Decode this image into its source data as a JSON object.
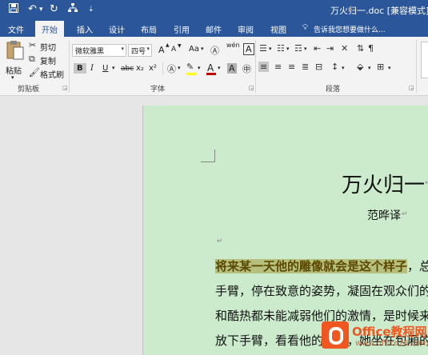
{
  "title_bar": {
    "save_icon": "save-icon",
    "undo_icon": "undo-icon",
    "redo_icon": "redo-icon",
    "network_icon": "tree-icon",
    "customize": "⇣",
    "document_title": "万火归一.doc [兼容模式] - W"
  },
  "tabs": [
    "文件",
    "开始",
    "插入",
    "设计",
    "布局",
    "引用",
    "邮件",
    "审阅",
    "视图"
  ],
  "active_tab": "开始",
  "tell_me": "告诉我您想要做什么...",
  "clipboard": {
    "paste": "粘贴",
    "cut": "剪切",
    "copy": "复制",
    "format_painter": "格式刷",
    "group_label": "剪贴板"
  },
  "font": {
    "font_name": "微软雅黑",
    "font_size": "四号",
    "group_label": "字体",
    "grow": "A",
    "shrink": "A",
    "case": "Aa",
    "bold": "B",
    "italic": "I",
    "underline": "U",
    "strike": "abc",
    "sub": "x₂",
    "sup": "x²",
    "font_color_letter": "A",
    "char_border": "A",
    "phonetic": "wén",
    "highlight_color": "#ffff00",
    "font_color": "#c00000"
  },
  "paragraph": {
    "group_label": "段落"
  },
  "document": {
    "title": "万火归一",
    "author": "范晔译",
    "lines": [
      {
        "highlight": "将来某一天他的雕像就会是这个样子",
        "rest": "，总督"
      },
      {
        "text": "手臂，停在致意的姿势，凝固在观众们的欢"
      },
      {
        "text": "和酷热都未能减弱他们的激情，是时候来完"
      },
      {
        "text": "放下手臂，看看他的妻子，她坐在包厢的一"
      }
    ]
  },
  "watermark": {
    "brand": "Office教程网",
    "url": "www.office26.com"
  }
}
